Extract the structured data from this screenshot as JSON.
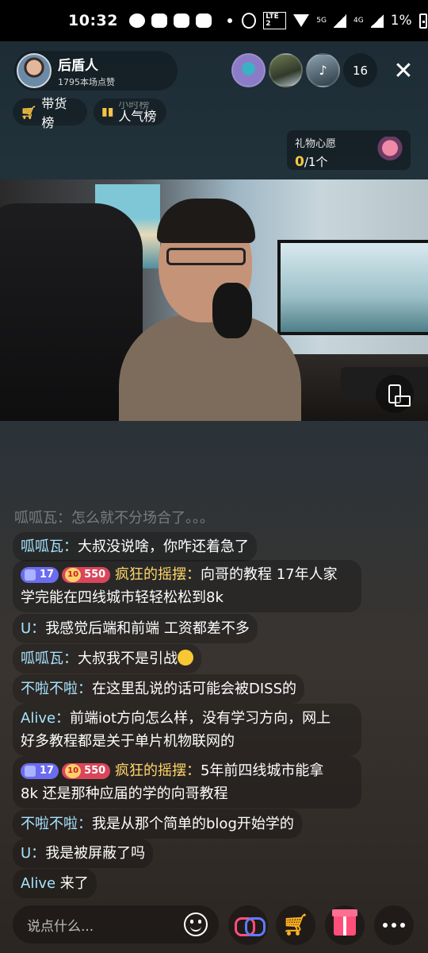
{
  "status_bar": {
    "time": "10:32",
    "battery": "1%",
    "network_a": "5G",
    "network_b": "4G",
    "lte_tag": "LTE 2"
  },
  "host": {
    "name": "后盾人",
    "likes": "1795本场点赞"
  },
  "viewers": {
    "count": "16"
  },
  "pills": {
    "goods": "带货榜",
    "popularity": "人气榜",
    "popularity_sub": "小时榜"
  },
  "wish": {
    "title": "礼物心愿",
    "current": "0",
    "total": "/1个"
  },
  "chat": {
    "faded_line": "呱呱瓦：怎么就不分场合了。。。",
    "messages": [
      {
        "user": "呱呱瓦：",
        "text": "大叔没说啥，你咋还着急了"
      },
      {
        "level": "17",
        "fan_level": "550",
        "user": "疯狂的摇摆：",
        "text_line1": "向哥的教程 17年人家",
        "text_line2": "学完能在四线城市轻轻松松到8k"
      },
      {
        "user": "U：",
        "text": "我感觉后端和前端 工资都差不多"
      },
      {
        "user": "呱呱瓦：",
        "text": "大叔我不是引战"
      },
      {
        "user": "不啦不啦：",
        "text": "在这里乱说的话可能会被DISS的"
      },
      {
        "user": "Alive：",
        "text_line1": "前端iot方向怎么样，没有学习方向，网上",
        "text_line2": "好多教程都是关于单片机物联网的"
      },
      {
        "level": "17",
        "fan_level": "550",
        "user": "疯狂的摇摆：",
        "text_line1": "5年前四线城市能拿",
        "text_line2": "8k 还是那种应届的学的向哥教程"
      },
      {
        "user": "不啦不啦：",
        "text": "我是从那个简单的blog开始学的"
      },
      {
        "user": "U：",
        "text": "我是被屏蔽了吗"
      },
      {
        "user": "Alive",
        "text": " 来了"
      }
    ]
  },
  "bottom_bar": {
    "input_placeholder": "说点什么..."
  }
}
